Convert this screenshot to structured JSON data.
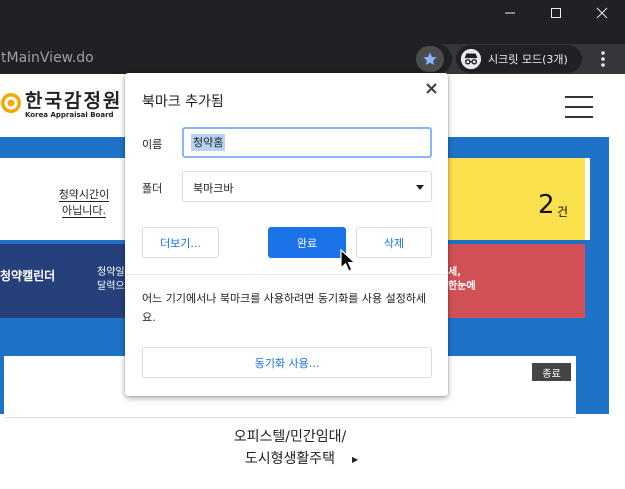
{
  "browser": {
    "url_fragment": "tMainView.do",
    "incognito_label": "시크릿 모드(3개)"
  },
  "page": {
    "logo_korean": "한국감정원",
    "logo_english": "Korea Appraisal Board",
    "notice_line1": "청약시간이",
    "notice_line2": "아닙니다.",
    "count_value": "2",
    "count_unit": "건",
    "calendar_label": "청약캘린더",
    "calendar_sub_line1": "청약일",
    "calendar_sub_line2": "달력으",
    "red_line1": "세,",
    "red_line2": "한눈에",
    "end_badge": "종료",
    "category_line1": "오피스텔/민간임대/",
    "category_line2": "도시형생활주택"
  },
  "bookmark_bubble": {
    "title": "북마크 추가됨",
    "name_label": "이름",
    "name_value": "청약홈",
    "folder_label": "폴더",
    "folder_value": "북마크바",
    "more_button": "더보기...",
    "done_button": "완료",
    "delete_button": "삭제",
    "sync_message": "어느 기기에서나 북마크를 사용하려면 동기화를 사용 설정하세요.",
    "sync_button": "동기화 사용..."
  },
  "colors": {
    "chrome_dark": "#202124",
    "accent_blue": "#1a73e8",
    "page_blue": "#1e73c8",
    "notice_yellow": "#fce14e",
    "calendar_navy": "#26407c",
    "alert_red": "#d25156"
  }
}
